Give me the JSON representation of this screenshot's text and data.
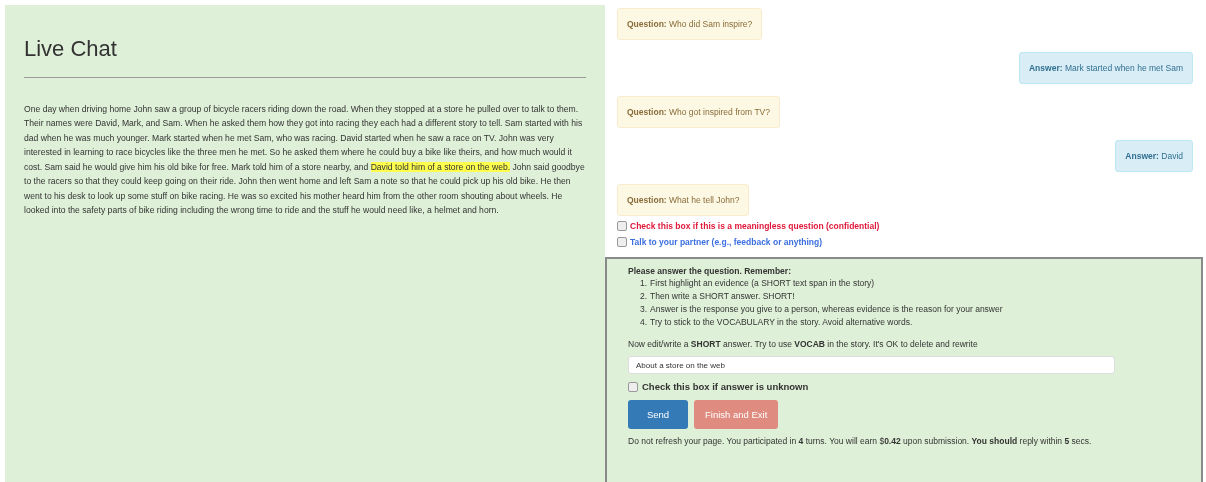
{
  "story": {
    "title": "Live Chat",
    "text_before": "One day when driving home John saw a group of bicycle racers riding down the road. When they stopped at a store he pulled over to talk to them. Their names were David, Mark, and Sam. When he asked them how they got into racing they each had a different story to tell. Sam started with his dad when he was much younger. Mark started when he met Sam, who was racing. David started when he saw a race on TV. John was very interested in learning to race bicycles like the three men he met. So he asked them where he could buy a bike like theirs, and how much would it cost. Sam said he would give him his old bike for free. Mark told him of a store nearby, and ",
    "evidence": "David told him of a store on the web.",
    "text_after": " John said goodbye to the racers so that they could keep going on their ride. John then went home and left Sam a note so that he could pick up his old bike. He then went to his desk to look up some stuff on bike racing. He was so excited his mother heard him from the other room shouting about wheels. He looked into the safety parts of bike riding including the wrong time to ride and the stuff he would need like, a helmet and horn."
  },
  "messages": [
    {
      "kind": "question",
      "text": "**Question:** Who did Sam inspire?"
    },
    {
      "kind": "answer",
      "text": "**Answer:** Mark started when he met Sam"
    },
    {
      "kind": "question",
      "text": "**Question:** Who got inspired from TV?"
    },
    {
      "kind": "answer",
      "text": "**Answer:** David"
    },
    {
      "kind": "question",
      "text": "**Question:** What he tell John?"
    }
  ],
  "flags": [
    {
      "label": "Check this box if this is a meaningless question (confidential)",
      "checked": false,
      "color": "#e0193a"
    },
    {
      "label": "Talk to your partner (e.g., feedback or anything)",
      "checked": false,
      "color": "#3b6fe0"
    }
  ],
  "answer_panel": {
    "heading": "Please answer the question. Remember:",
    "instructions": [
      {
        "number": "1.",
        "text": "First highlight an evidence (a SHORT text span in the story)"
      },
      {
        "number": "2.",
        "text": "Then write a SHORT answer. SHORT!"
      },
      {
        "number": "3.",
        "text": "Answer is the response you give to a person, whereas evidence is the reason for your answer"
      },
      {
        "number": "4.",
        "text": "Try to stick to the VOCABULARY in the story. Avoid alternative words."
      }
    ],
    "prompt": "Now edit/write a **SHORT** answer. Try to use **VOCAB** in the story. It's OK to delete and rewrite",
    "answer_value": "About a store on the web",
    "unknown": {
      "label": "Check this box if answer is unknown",
      "checked": false
    },
    "buttons": [
      {
        "label": "Send",
        "kind": "primary",
        "disabled": false
      },
      {
        "label": "Finish and Exit",
        "kind": "danger",
        "disabled": true
      }
    ],
    "footer": "Do not refresh your page. You participated in **4** turns. You will earn $**0.42** upon submission. **You should** reply within **5** secs."
  }
}
